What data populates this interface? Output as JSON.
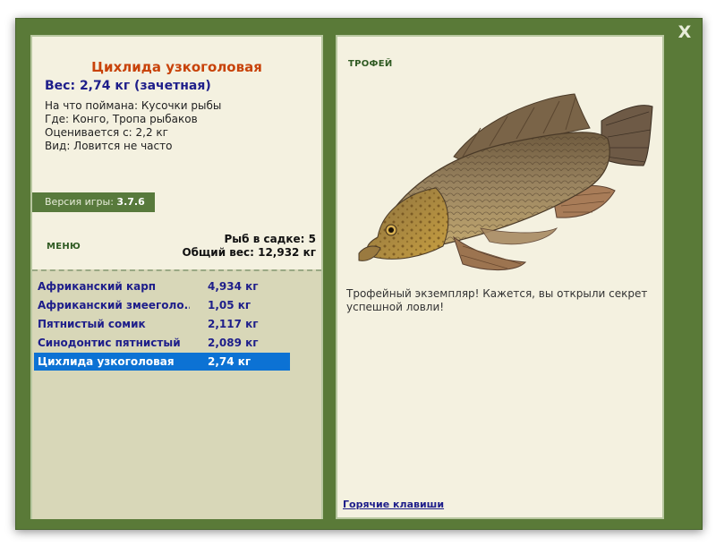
{
  "window": {
    "close_label": "X"
  },
  "fish": {
    "title": "Цихлида узкоголовая",
    "weight": "Вес: 2,74 кг (зачетная)",
    "caught_on": "На что поймана: Кусочки рыбы",
    "location": "Где: Конго, Тропа рыбаков",
    "valued_from": "Оценивается с: 2,2 кг",
    "frequency": "Вид: Ловится не часто"
  },
  "version": {
    "label": "Версия игры:",
    "value": "3.7.6"
  },
  "menu": {
    "label": "МЕНЮ"
  },
  "keepnet": {
    "fish_count": "Рыб в садке: 5",
    "total_weight": "Общий вес: 12,932 кг"
  },
  "catch_list": [
    {
      "name": "Африканский карп",
      "weight": "4,934 кг",
      "selected": false
    },
    {
      "name": "Африканский змееголо...",
      "weight": "1,05 кг",
      "selected": false
    },
    {
      "name": "Пятнистый сомик",
      "weight": "2,117 кг",
      "selected": false
    },
    {
      "name": "Синодонтис пятнистый",
      "weight": "2,089 кг",
      "selected": false
    },
    {
      "name": "Цихлида узкоголовая",
      "weight": "2,74 кг",
      "selected": true
    }
  ],
  "trophy": {
    "label": "ТРОФЕЙ",
    "message": "Трофейный экземпляр! Кажется, вы открыли секрет успешной ловли!"
  },
  "hotkeys": {
    "label": "Горячие клавиши"
  },
  "colors": {
    "frame": "#5a7a38",
    "panel": "#f4f1e0",
    "list_bg": "#d8d7b8",
    "title": "#c8430a",
    "accent_text": "#1e1e8a",
    "selection": "#0c72d4"
  }
}
